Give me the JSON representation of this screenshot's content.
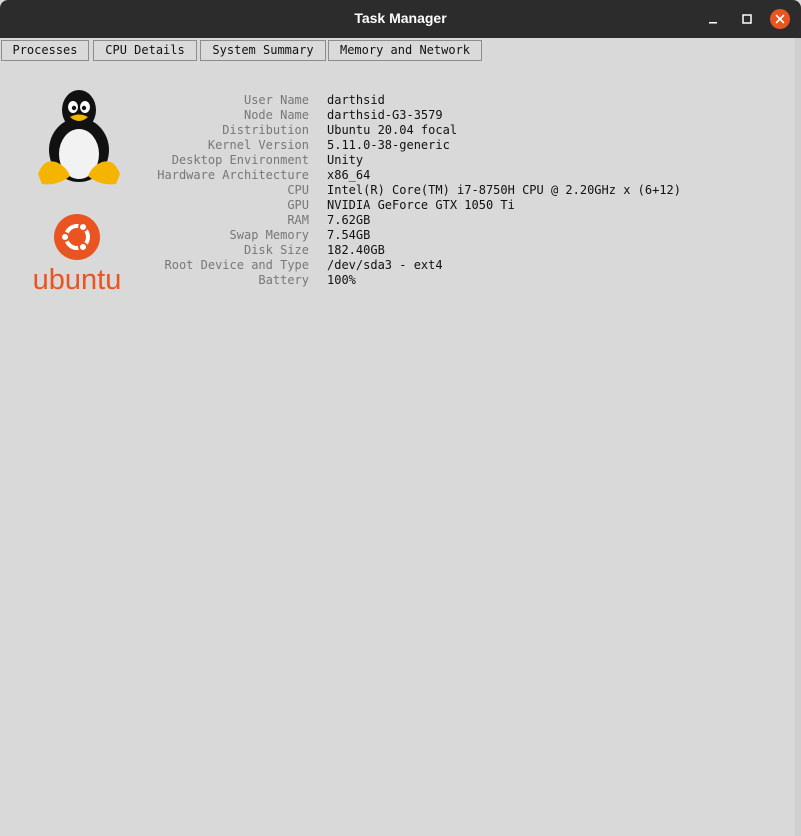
{
  "window": {
    "title": "Task Manager"
  },
  "tabs": [
    {
      "label": "Processes"
    },
    {
      "label": "CPU Details"
    },
    {
      "label": "System Summary"
    },
    {
      "label": "Memory and Network"
    }
  ],
  "colors": {
    "titlebar": "#2c2c2c",
    "close_button": "#e95420",
    "background": "#d9d9d9",
    "ubuntu_orange": "#e95420"
  },
  "logos": {
    "tux": "tux-penguin-logo",
    "ubuntu_text": "ubuntu"
  },
  "system_info": [
    {
      "label": "User Name",
      "value": "darthsid"
    },
    {
      "label": "Node Name",
      "value": "darthsid-G3-3579"
    },
    {
      "label": "Distribution",
      "value": "Ubuntu 20.04 focal"
    },
    {
      "label": "Kernel Version",
      "value": "5.11.0-38-generic"
    },
    {
      "label": "Desktop Environment",
      "value": "Unity"
    },
    {
      "label": "Hardware Architecture",
      "value": "x86_64"
    },
    {
      "label": "CPU",
      "value": "Intel(R) Core(TM) i7-8750H CPU @ 2.20GHz x (6+12)"
    },
    {
      "label": "GPU",
      "value": "NVIDIA GeForce GTX 1050 Ti"
    },
    {
      "label": "RAM",
      "value": "7.62GB"
    },
    {
      "label": "Swap Memory",
      "value": "7.54GB"
    },
    {
      "label": "Disk Size",
      "value": "182.40GB"
    },
    {
      "label": "Root Device and Type",
      "value": "/dev/sda3 - ext4"
    },
    {
      "label": "Battery",
      "value": "100%"
    }
  ]
}
